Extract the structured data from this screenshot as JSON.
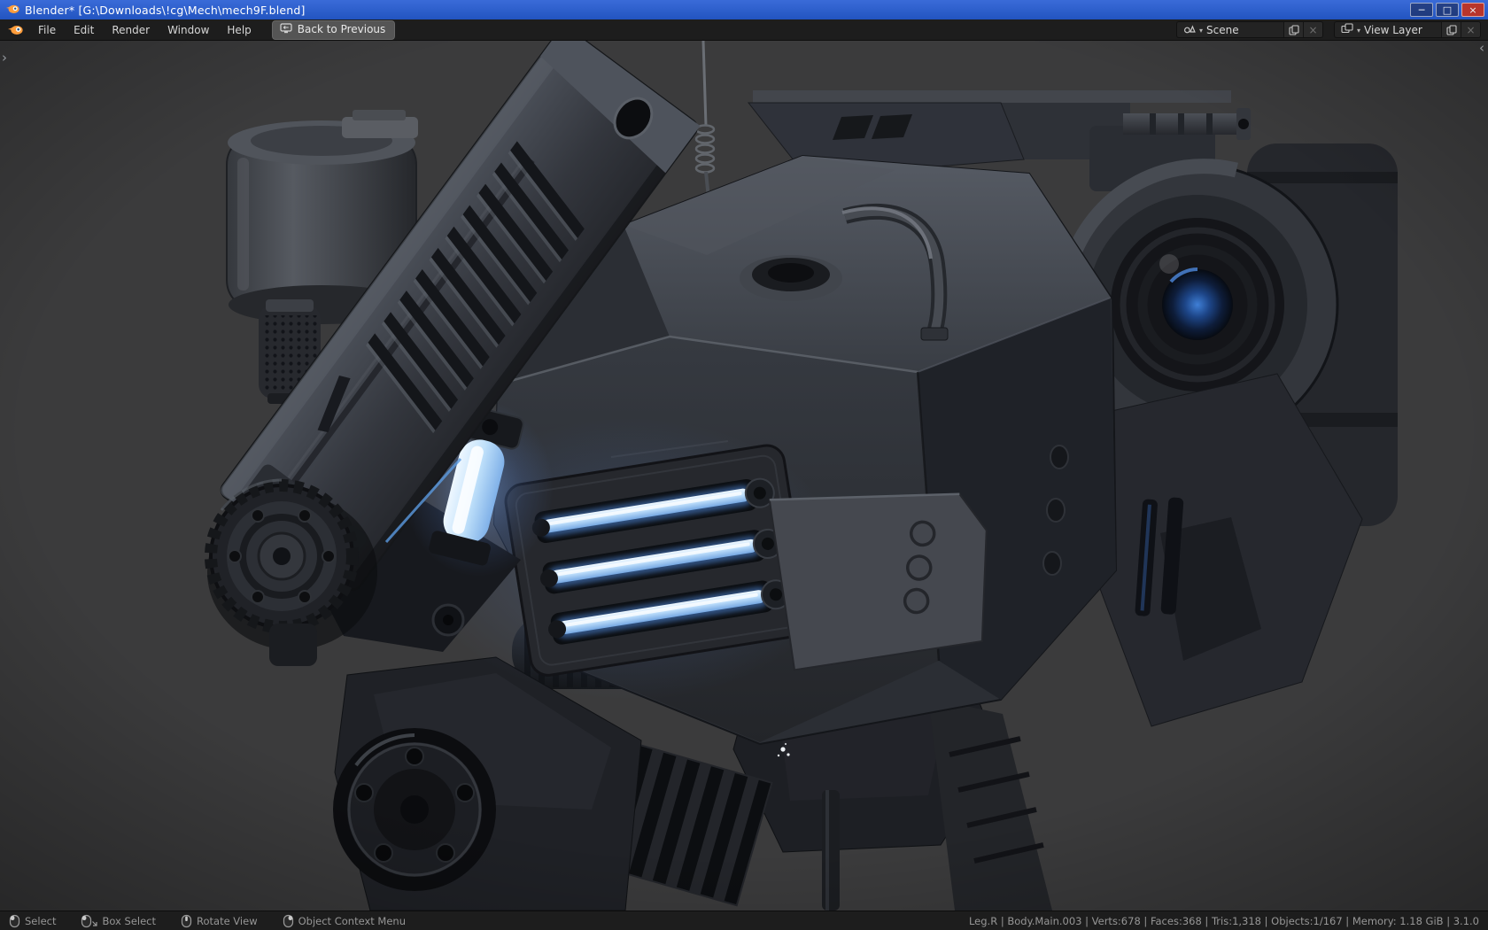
{
  "window": {
    "title": "Blender* [G:\\Downloads\\!cg\\Mech\\mech9F.blend]"
  },
  "icons": {
    "minimize": "─",
    "maximize": "□",
    "close": "×",
    "caret": "▾",
    "unlink": "×",
    "panel_open": "›",
    "panel_close": "‹"
  },
  "menubar": {
    "menus": [
      {
        "label": "File"
      },
      {
        "label": "Edit"
      },
      {
        "label": "Render"
      },
      {
        "label": "Window"
      },
      {
        "label": "Help"
      }
    ],
    "back_label": "Back to Previous"
  },
  "header_right": {
    "scene": {
      "value": "Scene"
    },
    "view_layer": {
      "value": "View Layer"
    }
  },
  "statusbar": {
    "hints": [
      {
        "icon": "mouse-left",
        "label": "Select"
      },
      {
        "icon": "mouse-drag",
        "label": "Box Select"
      },
      {
        "icon": "mouse-middle",
        "label": "Rotate View"
      },
      {
        "icon": "mouse-right",
        "label": "Object Context Menu"
      }
    ],
    "stats": "Leg.R | Body.Main.003 | Verts:678 | Faces:368 | Tris:1,318 | Objects:1/167 | Memory: 1.18 GiB | 3.1.0"
  },
  "colors": {
    "titlebar": "#2254c0",
    "titlebar_hi": "#3a6bd8",
    "chrome": "#1d1d1d",
    "viewport_bg": "#3b3b3c",
    "text": "#d6d6d6",
    "dim_text": "#969696",
    "glow_blue": "#9ecbff",
    "mech_dark": "#1d1f24",
    "mech_mid": "#2c2f35",
    "mech_light": "#4a4e56"
  }
}
